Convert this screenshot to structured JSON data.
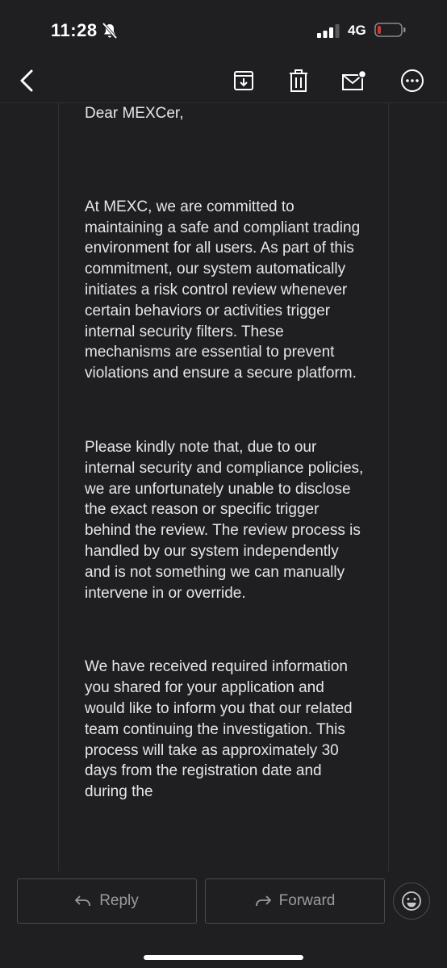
{
  "status_bar": {
    "time": "11:28",
    "network": "4G"
  },
  "toolbar": {
    "back_icon": "chevron-left-icon",
    "archive_icon": "archive-icon",
    "trash_icon": "trash-icon",
    "unread_icon": "mark-unread-icon",
    "more_icon": "more-icon"
  },
  "email": {
    "greeting": "Dear MEXCer,",
    "paragraphs": [
      "At MEXC, we are committed to maintaining a safe and compliant trading environment for all users. As part of this commitment, our system automatically initiates a risk control review whenever certain behaviors or activities trigger internal security filters. These mechanisms are essential to prevent violations and ensure a secure platform.",
      "Please kindly note that, due to our internal security and compliance policies, we are unfortunately unable to disclose the exact reason or specific trigger behind the review. The review process is handled by our system independently and is not something we can manually intervene in or override.",
      "We have received required information you shared for your application and would like to inform you that our related team continuing the investigation. This process will take as approximately 30 days from the registration date and during the"
    ]
  },
  "actions": {
    "reply_label": "Reply",
    "forward_label": "Forward"
  },
  "colors": {
    "background": "#1f1f21",
    "text": "#e6e6e8",
    "border": "#4a4a4e",
    "battery_low": "#e0312f"
  }
}
